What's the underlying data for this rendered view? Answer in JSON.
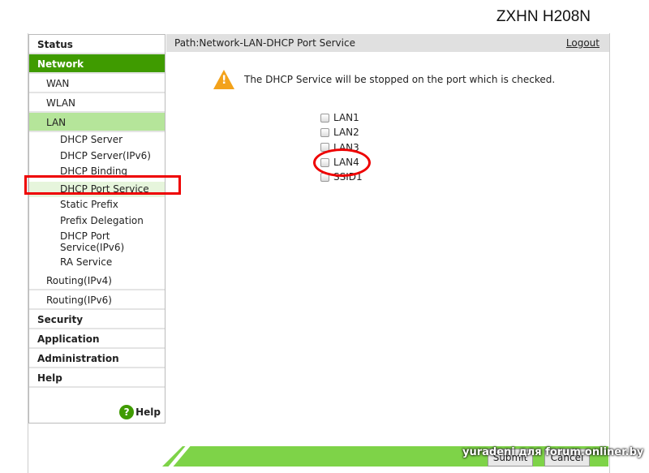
{
  "header": {
    "model": "ZXHN H208N"
  },
  "sidebar": {
    "items": [
      {
        "label": "Status",
        "level": "top"
      },
      {
        "label": "Network",
        "level": "top",
        "active": true
      },
      {
        "label": "WAN",
        "level": "sub"
      },
      {
        "label": "WLAN",
        "level": "sub"
      },
      {
        "label": "LAN",
        "level": "sub",
        "active": true
      },
      {
        "label": "DHCP Server",
        "level": "leaf"
      },
      {
        "label": "DHCP Server(IPv6)",
        "level": "leaf"
      },
      {
        "label": "DHCP Binding",
        "level": "leaf"
      },
      {
        "label": "DHCP Port Service",
        "level": "leaf",
        "active": true
      },
      {
        "label": "Static Prefix",
        "level": "leaf"
      },
      {
        "label": "Prefix Delegation",
        "level": "leaf"
      },
      {
        "label": "DHCP Port Service(IPv6)",
        "level": "leaf"
      },
      {
        "label": "RA Service",
        "level": "leaf"
      },
      {
        "label": "Routing(IPv4)",
        "level": "sub"
      },
      {
        "label": "Routing(IPv6)",
        "level": "sub"
      },
      {
        "label": "Security",
        "level": "top"
      },
      {
        "label": "Application",
        "level": "top"
      },
      {
        "label": "Administration",
        "level": "top"
      },
      {
        "label": "Help",
        "level": "top"
      }
    ],
    "help_label": "Help"
  },
  "path": {
    "text": "Path:Network-LAN-DHCP Port Service",
    "logout": "Logout"
  },
  "main": {
    "warning": "The DHCP Service will be stopped on the port which is checked.",
    "ports": [
      {
        "label": "LAN1",
        "checked": false
      },
      {
        "label": "LAN2",
        "checked": false
      },
      {
        "label": "LAN3",
        "checked": false
      },
      {
        "label": "LAN4",
        "checked": false
      },
      {
        "label": "SSID1",
        "checked": false
      }
    ],
    "submit": "Submit",
    "cancel": "Cancel"
  },
  "watermark": "yuradeni для forum.onliner.by",
  "colors": {
    "accent": "#3f9b00",
    "light": "#b5e59a",
    "bar": "#7ed348",
    "annotation": "#e00000"
  }
}
